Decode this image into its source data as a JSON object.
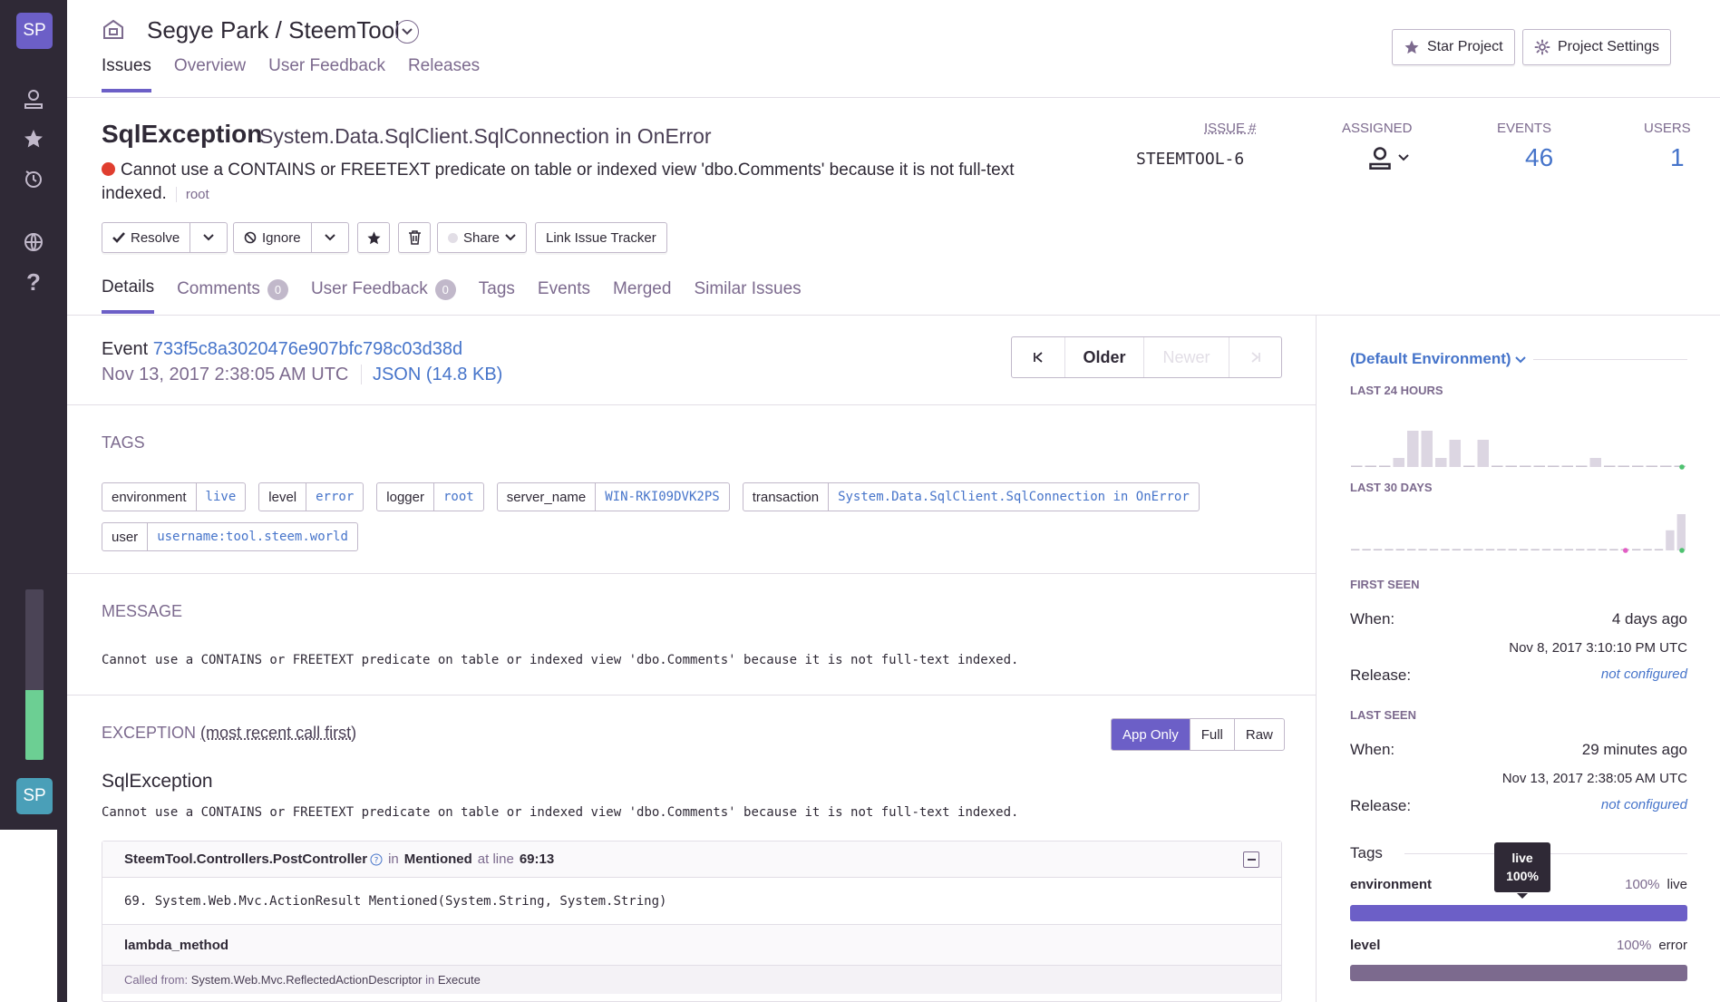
{
  "sidebar": {
    "org_initials": "SP",
    "user_initials": "SP",
    "progress_fraction": 0.41,
    "colors": {
      "bg": "#2f2936",
      "accent": "#6c5fc7",
      "progress": "#6ccf93"
    }
  },
  "header": {
    "org": "Segye Park",
    "separator": "/",
    "project": "SteemTool",
    "tabs": [
      "Issues",
      "Overview",
      "User Feedback",
      "Releases"
    ],
    "star_label": "Star Project",
    "settings_label": "Project Settings"
  },
  "issue": {
    "type": "SqlException",
    "culprit": "System.Data.SqlClient.SqlConnection in OnError",
    "message": "Cannot use a CONTAINS or FREETEXT predicate on table or indexed view 'dbo.Comments' because it is not full-text indexed.",
    "logger": "root",
    "issue_label": "ISSUE #",
    "issue_id": "STEEMTOOL-6",
    "assigned_label": "ASSIGNED",
    "events_label": "EVENTS",
    "events": "46",
    "users_label": "USERS",
    "users": "1"
  },
  "actions": {
    "resolve": "Resolve",
    "ignore": "Ignore",
    "share": "Share",
    "link_tracker": "Link Issue Tracker"
  },
  "subtabs": {
    "details": "Details",
    "comments": "Comments",
    "comments_count": "0",
    "user_feedback": "User Feedback",
    "user_feedback_count": "0",
    "tags": "Tags",
    "events": "Events",
    "merged": "Merged",
    "similar": "Similar Issues"
  },
  "event": {
    "label": "Event",
    "id": "733f5c8a3020476e907bfc798c03d38d",
    "date": "Nov 13, 2017 2:38:05 AM UTC",
    "json": "JSON (14.8 KB)",
    "older": "Older",
    "newer": "Newer"
  },
  "tags_section": {
    "title": "TAGS",
    "items": [
      {
        "key": "environment",
        "value": "live"
      },
      {
        "key": "level",
        "value": "error"
      },
      {
        "key": "logger",
        "value": "root"
      },
      {
        "key": "server_name",
        "value": "WIN-RKI09DVK2PS"
      },
      {
        "key": "transaction",
        "value": "System.Data.SqlClient.SqlConnection in OnError"
      },
      {
        "key": "user",
        "value": "username:tool.steem.world"
      }
    ]
  },
  "message_section": {
    "title": "MESSAGE",
    "text": "Cannot use a CONTAINS or FREETEXT predicate on table or indexed view 'dbo.Comments' because it is not full-text indexed."
  },
  "exception_section": {
    "title": "EXCEPTION",
    "subtitle": "(most recent call first)",
    "app_only": "App Only",
    "full": "Full",
    "raw": "Raw",
    "type": "SqlException",
    "value": "Cannot use a CONTAINS or FREETEXT predicate on table or indexed view 'dbo.Comments' because it is not full-text indexed.",
    "frame1_module": "SteemTool.Controllers.PostController",
    "frame1_in": "in",
    "frame1_function": "Mentioned",
    "frame1_at": "at line",
    "frame1_line": "69:13",
    "frame1_code": "69.  System.Web.Mvc.ActionResult Mentioned(System.String, System.String)",
    "frame2_function": "lambda_method",
    "frame2_called_from_label": "Called from:",
    "frame2_called_from": "System.Web.Mvc.ReflectedActionDescriptor",
    "frame2_in": "in",
    "frame2_execute": "Execute"
  },
  "right": {
    "environment": "(Default Environment)",
    "last24": "LAST 24 HOURS",
    "last30": "LAST 30 DAYS",
    "spark24": [
      0,
      0,
      0,
      1,
      4,
      4,
      1,
      3,
      0,
      3,
      0,
      0,
      0,
      0,
      0,
      0,
      0,
      1,
      0,
      0,
      0,
      0,
      0,
      0
    ],
    "spark30": [
      0,
      0,
      0,
      0,
      0,
      0,
      0,
      0,
      0,
      0,
      0,
      0,
      0,
      0,
      0,
      0,
      0,
      0,
      0,
      0,
      0,
      0,
      0,
      0,
      0,
      0,
      0,
      0,
      5,
      9
    ],
    "first_seen": "FIRST SEEN",
    "first_when_label": "When:",
    "first_when": "4 days ago",
    "first_when_date": "Nov 8, 2017 3:10:10 PM UTC",
    "first_release_label": "Release:",
    "first_release": "not configured",
    "last_seen": "LAST SEEN",
    "last_when_label": "When:",
    "last_when": "29 minutes ago",
    "last_when_date": "Nov 13, 2017 2:38:05 AM UTC",
    "last_release_label": "Release:",
    "last_release": "not configured",
    "tags_title": "Tags",
    "tag1_key": "environment",
    "tag1_pct": "100%",
    "tag1_val": "live",
    "tag1_fraction": 1.0,
    "tag2_key": "level",
    "tag2_pct": "100%",
    "tag2_val": "error",
    "tag2_fraction": 1.0,
    "tooltip_val": "live",
    "tooltip_pct": "100%",
    "colors": {
      "env_bar": "#6c5fc7",
      "level_bar": "#7c6a8e"
    }
  }
}
